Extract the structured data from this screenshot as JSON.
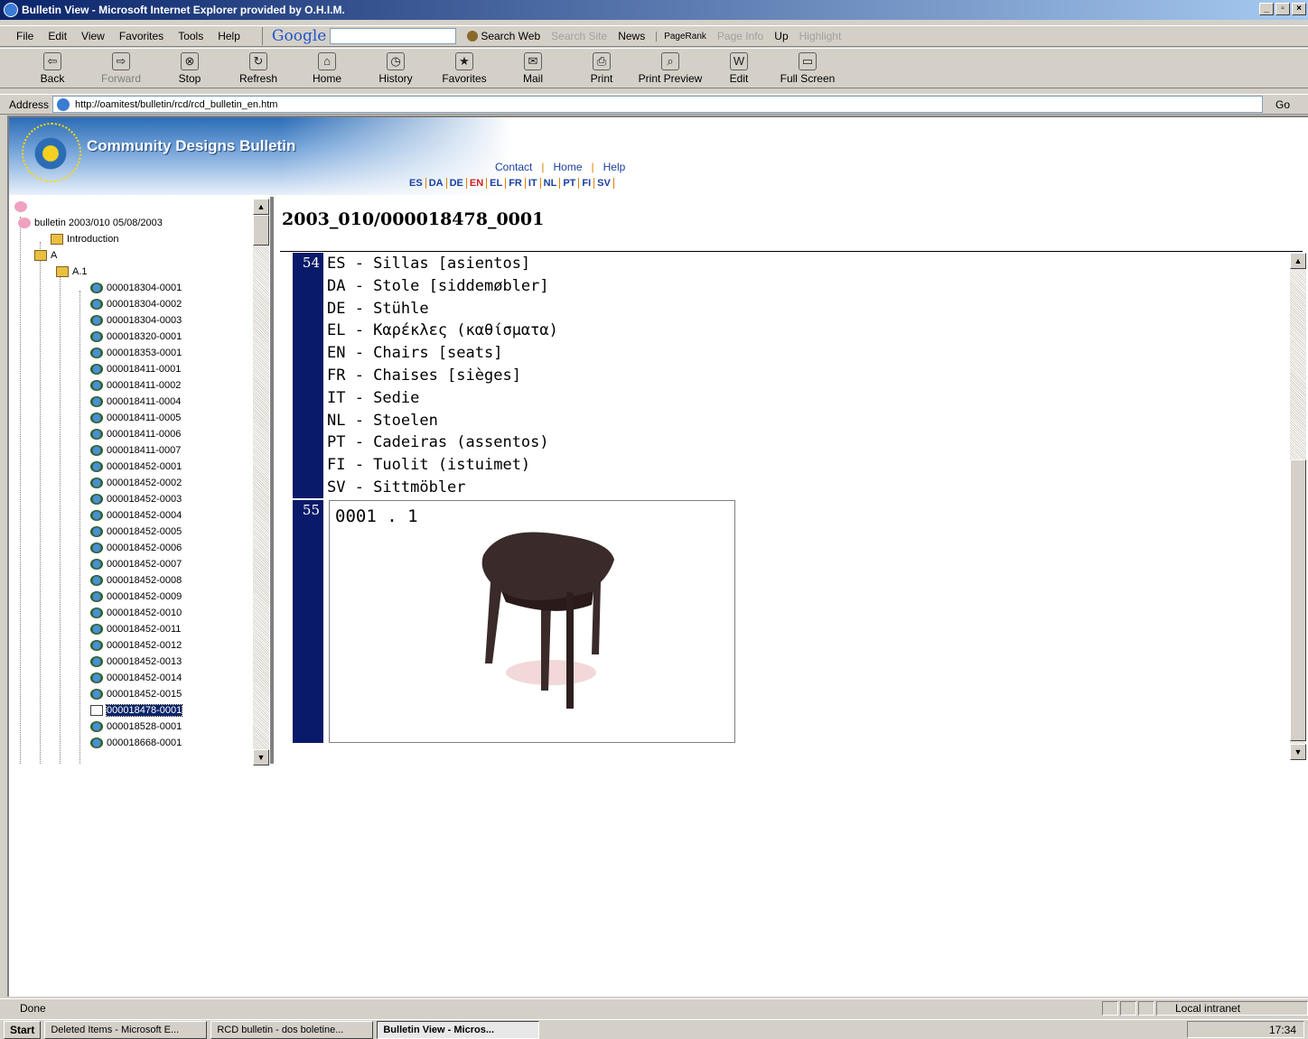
{
  "window": {
    "title": "Bulletin View - Microsoft Internet Explorer provided by O.H.I.M."
  },
  "menu": [
    "File",
    "Edit",
    "View",
    "Favorites",
    "Tools",
    "Help"
  ],
  "google_toolbar": {
    "logo": "Google",
    "search_web": "Search Web",
    "search_site": "Search Site",
    "news": "News",
    "pagerank": "PageRank",
    "page_info": "Page Info",
    "up": "Up",
    "highlight": "Highlight"
  },
  "toolbar": [
    {
      "label": "Back",
      "icon": "back-arrow-icon",
      "enabled": true
    },
    {
      "label": "Forward",
      "icon": "forward-arrow-icon",
      "enabled": false
    },
    {
      "label": "Stop",
      "icon": "stop-icon",
      "enabled": true
    },
    {
      "label": "Refresh",
      "icon": "refresh-icon",
      "enabled": true
    },
    {
      "label": "Home",
      "icon": "home-icon",
      "enabled": true
    },
    {
      "label": "History",
      "icon": "history-icon",
      "enabled": true
    },
    {
      "label": "Favorites",
      "icon": "favorites-icon",
      "enabled": true
    },
    {
      "label": "Mail",
      "icon": "mail-icon",
      "enabled": true
    },
    {
      "label": "Print",
      "icon": "print-icon",
      "enabled": true
    },
    {
      "label": "Print Preview",
      "icon": "print-preview-icon",
      "enabled": true
    },
    {
      "label": "Edit",
      "icon": "edit-icon",
      "enabled": true
    },
    {
      "label": "Full Screen",
      "icon": "full-screen-icon",
      "enabled": true
    }
  ],
  "address": {
    "label": "Address",
    "value": "http://oamitest/bulletin/rcd/rcd_bulletin_en.htm",
    "go": "Go"
  },
  "banner": {
    "title": "Community Designs Bulletin",
    "links": [
      "Contact",
      "Home",
      "Help"
    ],
    "languages": [
      "ES",
      "DA",
      "DE",
      "EN",
      "EL",
      "FR",
      "IT",
      "NL",
      "PT",
      "FI",
      "SV"
    ],
    "active_language": "EN"
  },
  "tree": {
    "root": "bulletin 2003/010 05/08/2003",
    "introduction": "Introduction",
    "section": "A",
    "subsection": "A.1",
    "items": [
      "000018304-0001",
      "000018304-0002",
      "000018304-0003",
      "000018320-0001",
      "000018353-0001",
      "000018411-0001",
      "000018411-0002",
      "000018411-0004",
      "000018411-0005",
      "000018411-0006",
      "000018411-0007",
      "000018452-0001",
      "000018452-0002",
      "000018452-0003",
      "000018452-0004",
      "000018452-0005",
      "000018452-0006",
      "000018452-0007",
      "000018452-0008",
      "000018452-0009",
      "000018452-0010",
      "000018452-0011",
      "000018452-0012",
      "000018452-0013",
      "000018452-0014",
      "000018452-0015",
      "000018478-0001",
      "000018528-0001",
      "000018668-0001"
    ],
    "selected": "000018478-0001"
  },
  "document": {
    "heading": "2003_010/000018478_0001",
    "field54": {
      "num": "54",
      "names": [
        "ES - Sillas [asientos]",
        "DA - Stole [siddemøbler]",
        "DE - Stühle",
        "EL - Καρέκλες (καθίσματα)",
        "EN - Chairs [seats]",
        "FR - Chaises [sièges]",
        "IT - Sedie",
        "NL - Stoelen",
        "PT - Cadeiras (assentos)",
        "FI - Tuolit (istuimet)",
        "SV - Sittmöbler"
      ]
    },
    "field55": {
      "num": "55",
      "caption": "0001 . 1"
    }
  },
  "status": {
    "text": "Done",
    "zone": "Local intranet"
  },
  "taskbar": {
    "start": "Start",
    "tasks": [
      "Deleted Items - Microsoft E...",
      "RCD bulletin - dos boletine...",
      "Bulletin View - Micros..."
    ],
    "active": 2,
    "clock": "17:34"
  }
}
